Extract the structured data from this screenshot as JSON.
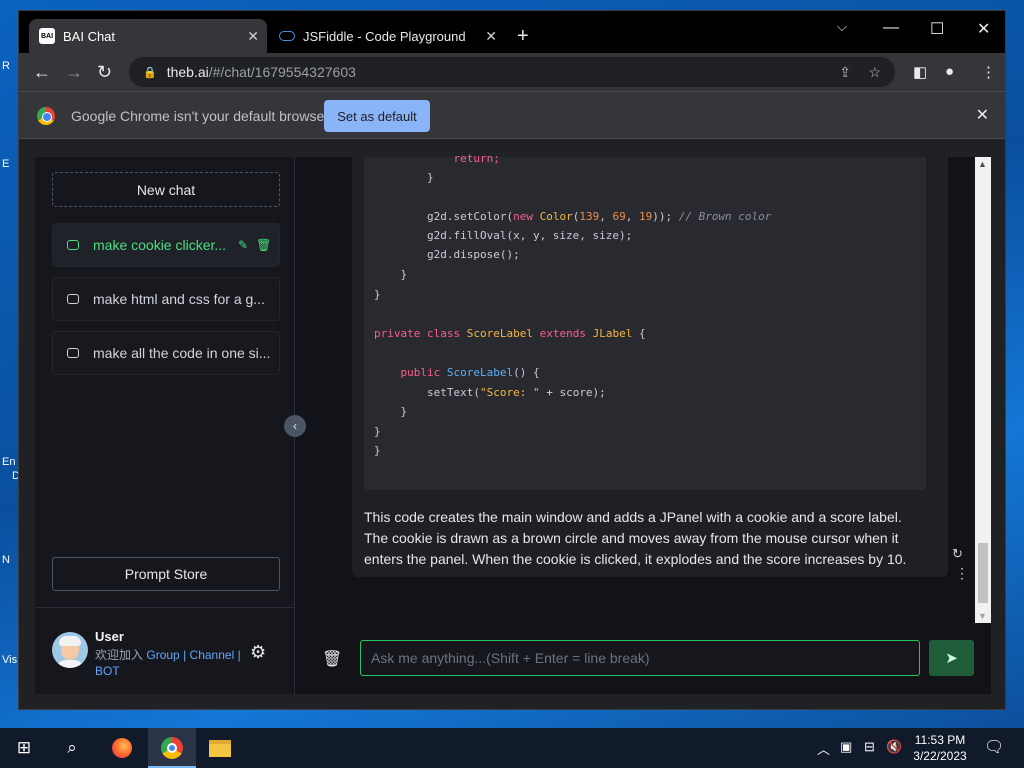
{
  "browser": {
    "tabs": [
      {
        "label": "BAI Chat",
        "favicon": "BAI"
      },
      {
        "label": "JSFiddle - Code Playground"
      }
    ],
    "url_host": "theb.ai",
    "url_path": "/#/chat/1679554327603",
    "infobar": {
      "message": "Google Chrome isn't your default browser",
      "button": "Set as default"
    }
  },
  "sidebar": {
    "new_chat": "New chat",
    "chats": [
      {
        "title": "make cookie clicker..."
      },
      {
        "title": "make html and css for a g..."
      },
      {
        "title": "make all the code in one si..."
      }
    ],
    "prompt_store": "Prompt Store",
    "user": {
      "name": "User",
      "subtitle_prefix": "欢迎加入",
      "group": "Group",
      "sep": "|",
      "channel": "Channel",
      "bot": "BOT"
    }
  },
  "code_lines": [
    "            return;",
    "        }",
    "",
    "        g2d.setColor(new Color(139, 69, 19)); // Brown color",
    "        g2d.fillOval(x, y, size, size);",
    "        g2d.dispose();",
    "    }",
    "}",
    "",
    "private class ScoreLabel extends JLabel {",
    "",
    "    public ScoreLabel() {",
    "        setText(\"Score: \" + score);",
    "    }",
    "}",
    "}"
  ],
  "message": {
    "explanation": "This code creates the main window and adds a JPanel with a cookie and a score label. The cookie is drawn as a brown circle and moves away from the mouse cursor when it enters the panel. When the cookie is clicked, it explodes and the score increases by 10."
  },
  "composer": {
    "placeholder": "Ask me anything...(Shift + Enter = line break)"
  },
  "taskbar": {
    "time": "11:53 PM",
    "date": "3/22/2023"
  },
  "colors": {
    "accent_green": "#22c55e",
    "link_blue": "#60a5fa",
    "chrome_blue": "#8ab4f8"
  }
}
